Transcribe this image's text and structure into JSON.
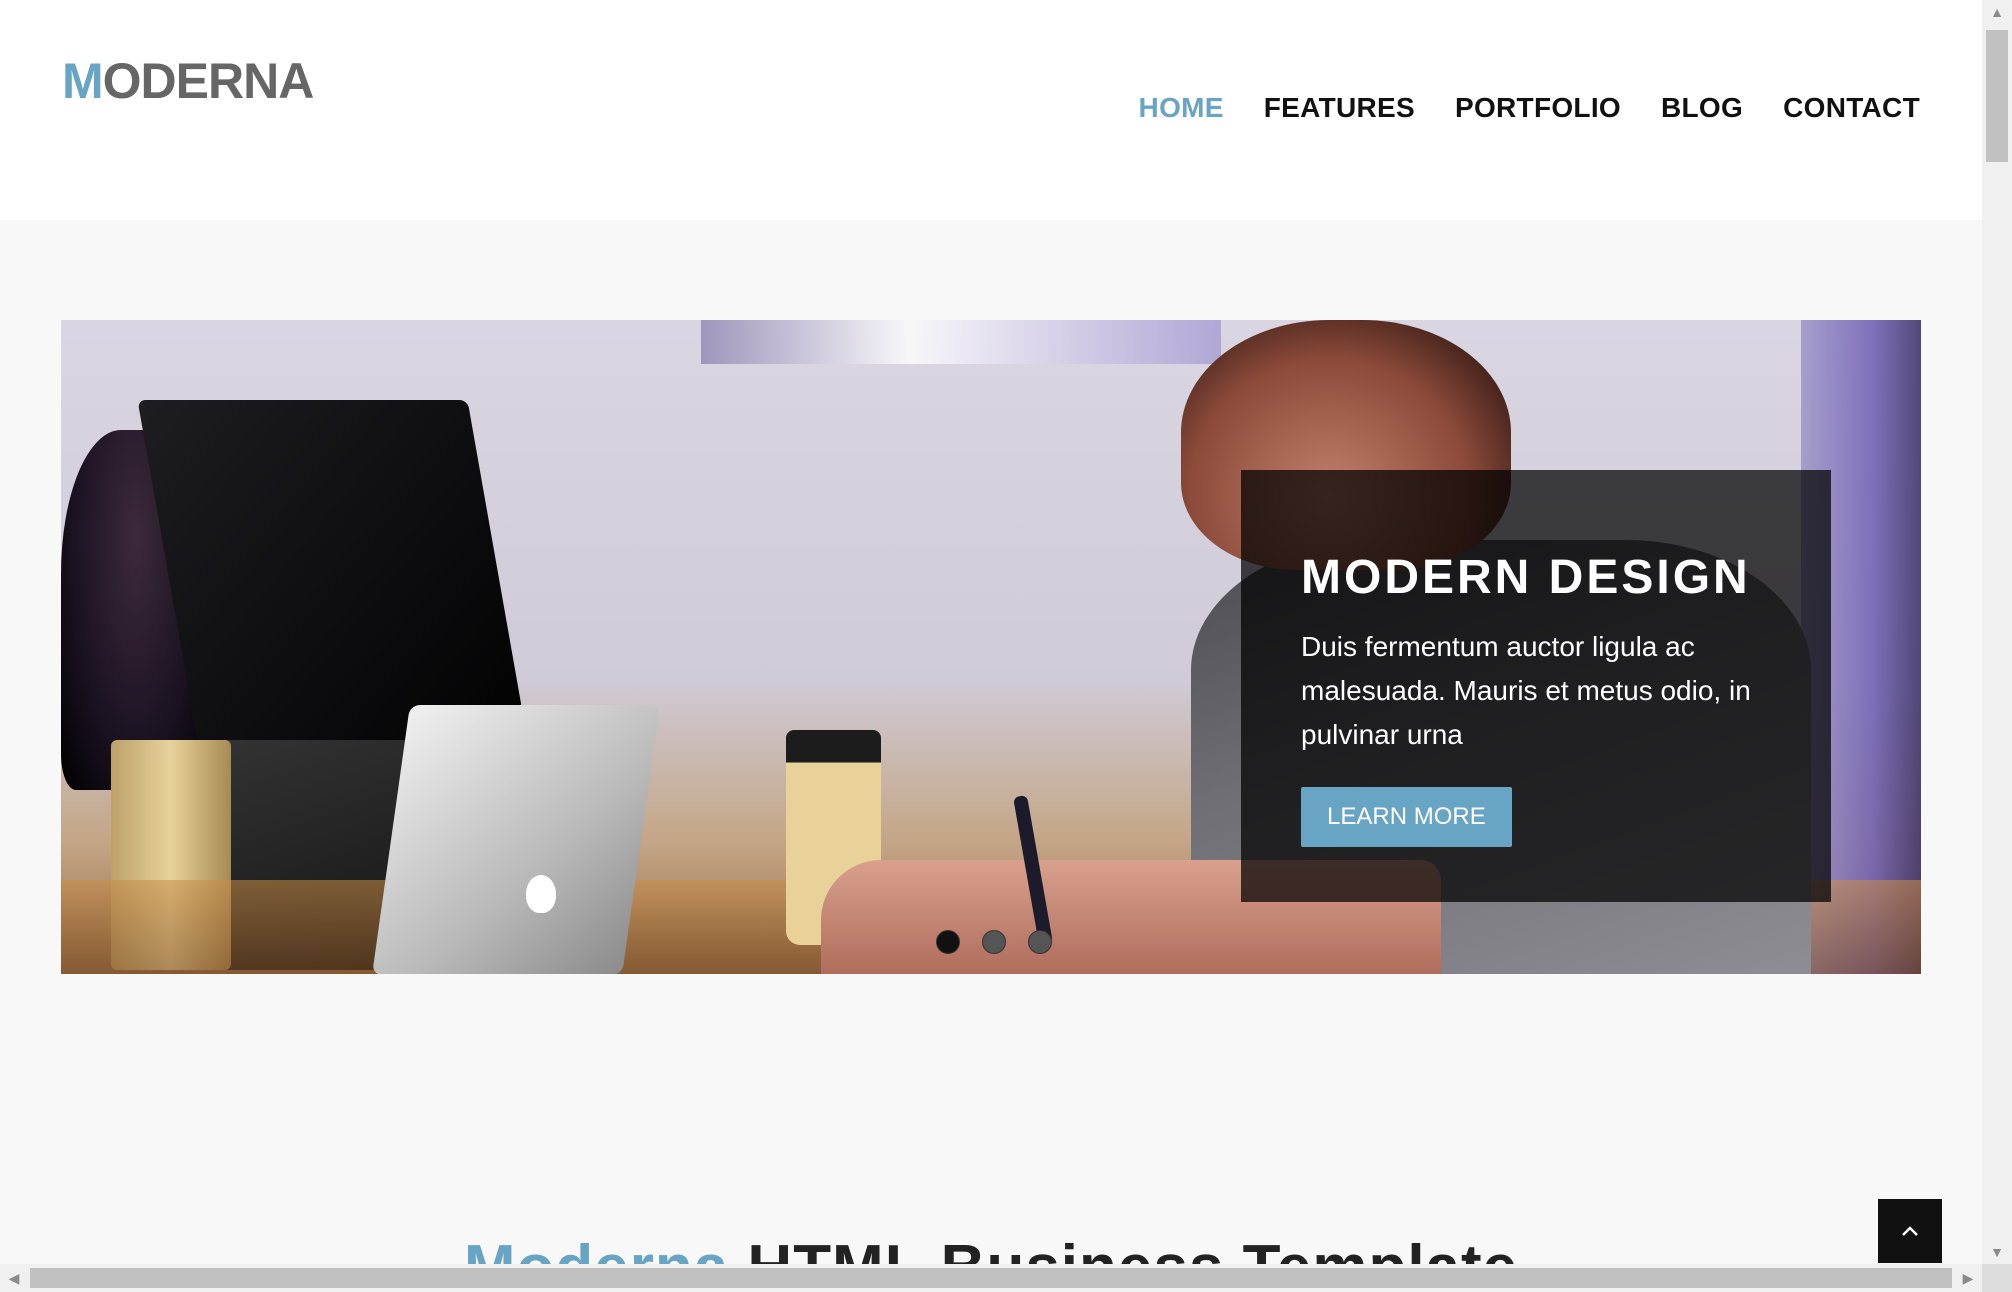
{
  "header": {
    "logo_first": "M",
    "logo_rest": "ODERNA",
    "nav": [
      {
        "label": "HOME",
        "active": true
      },
      {
        "label": "FEATURES",
        "active": false
      },
      {
        "label": "PORTFOLIO",
        "active": false
      },
      {
        "label": "BLOG",
        "active": false
      },
      {
        "label": "CONTACT",
        "active": false
      }
    ]
  },
  "slider": {
    "title": "MODERN DESIGN",
    "text": "Duis fermentum auctor ligula ac malesuada. Mauris et metus odio, in pulvinar urna",
    "button": "LEARN MORE",
    "slide_count": 3,
    "active_slide": 1
  },
  "section": {
    "title_accent": "Moderna",
    "title_rest": " HTML Business Template"
  },
  "colors": {
    "accent": "#68a4c4",
    "text_dark": "#111111",
    "caption_bg": "rgba(0,0,0,0.72)"
  },
  "icons": {
    "back_to_top": "chevron-up-icon"
  }
}
